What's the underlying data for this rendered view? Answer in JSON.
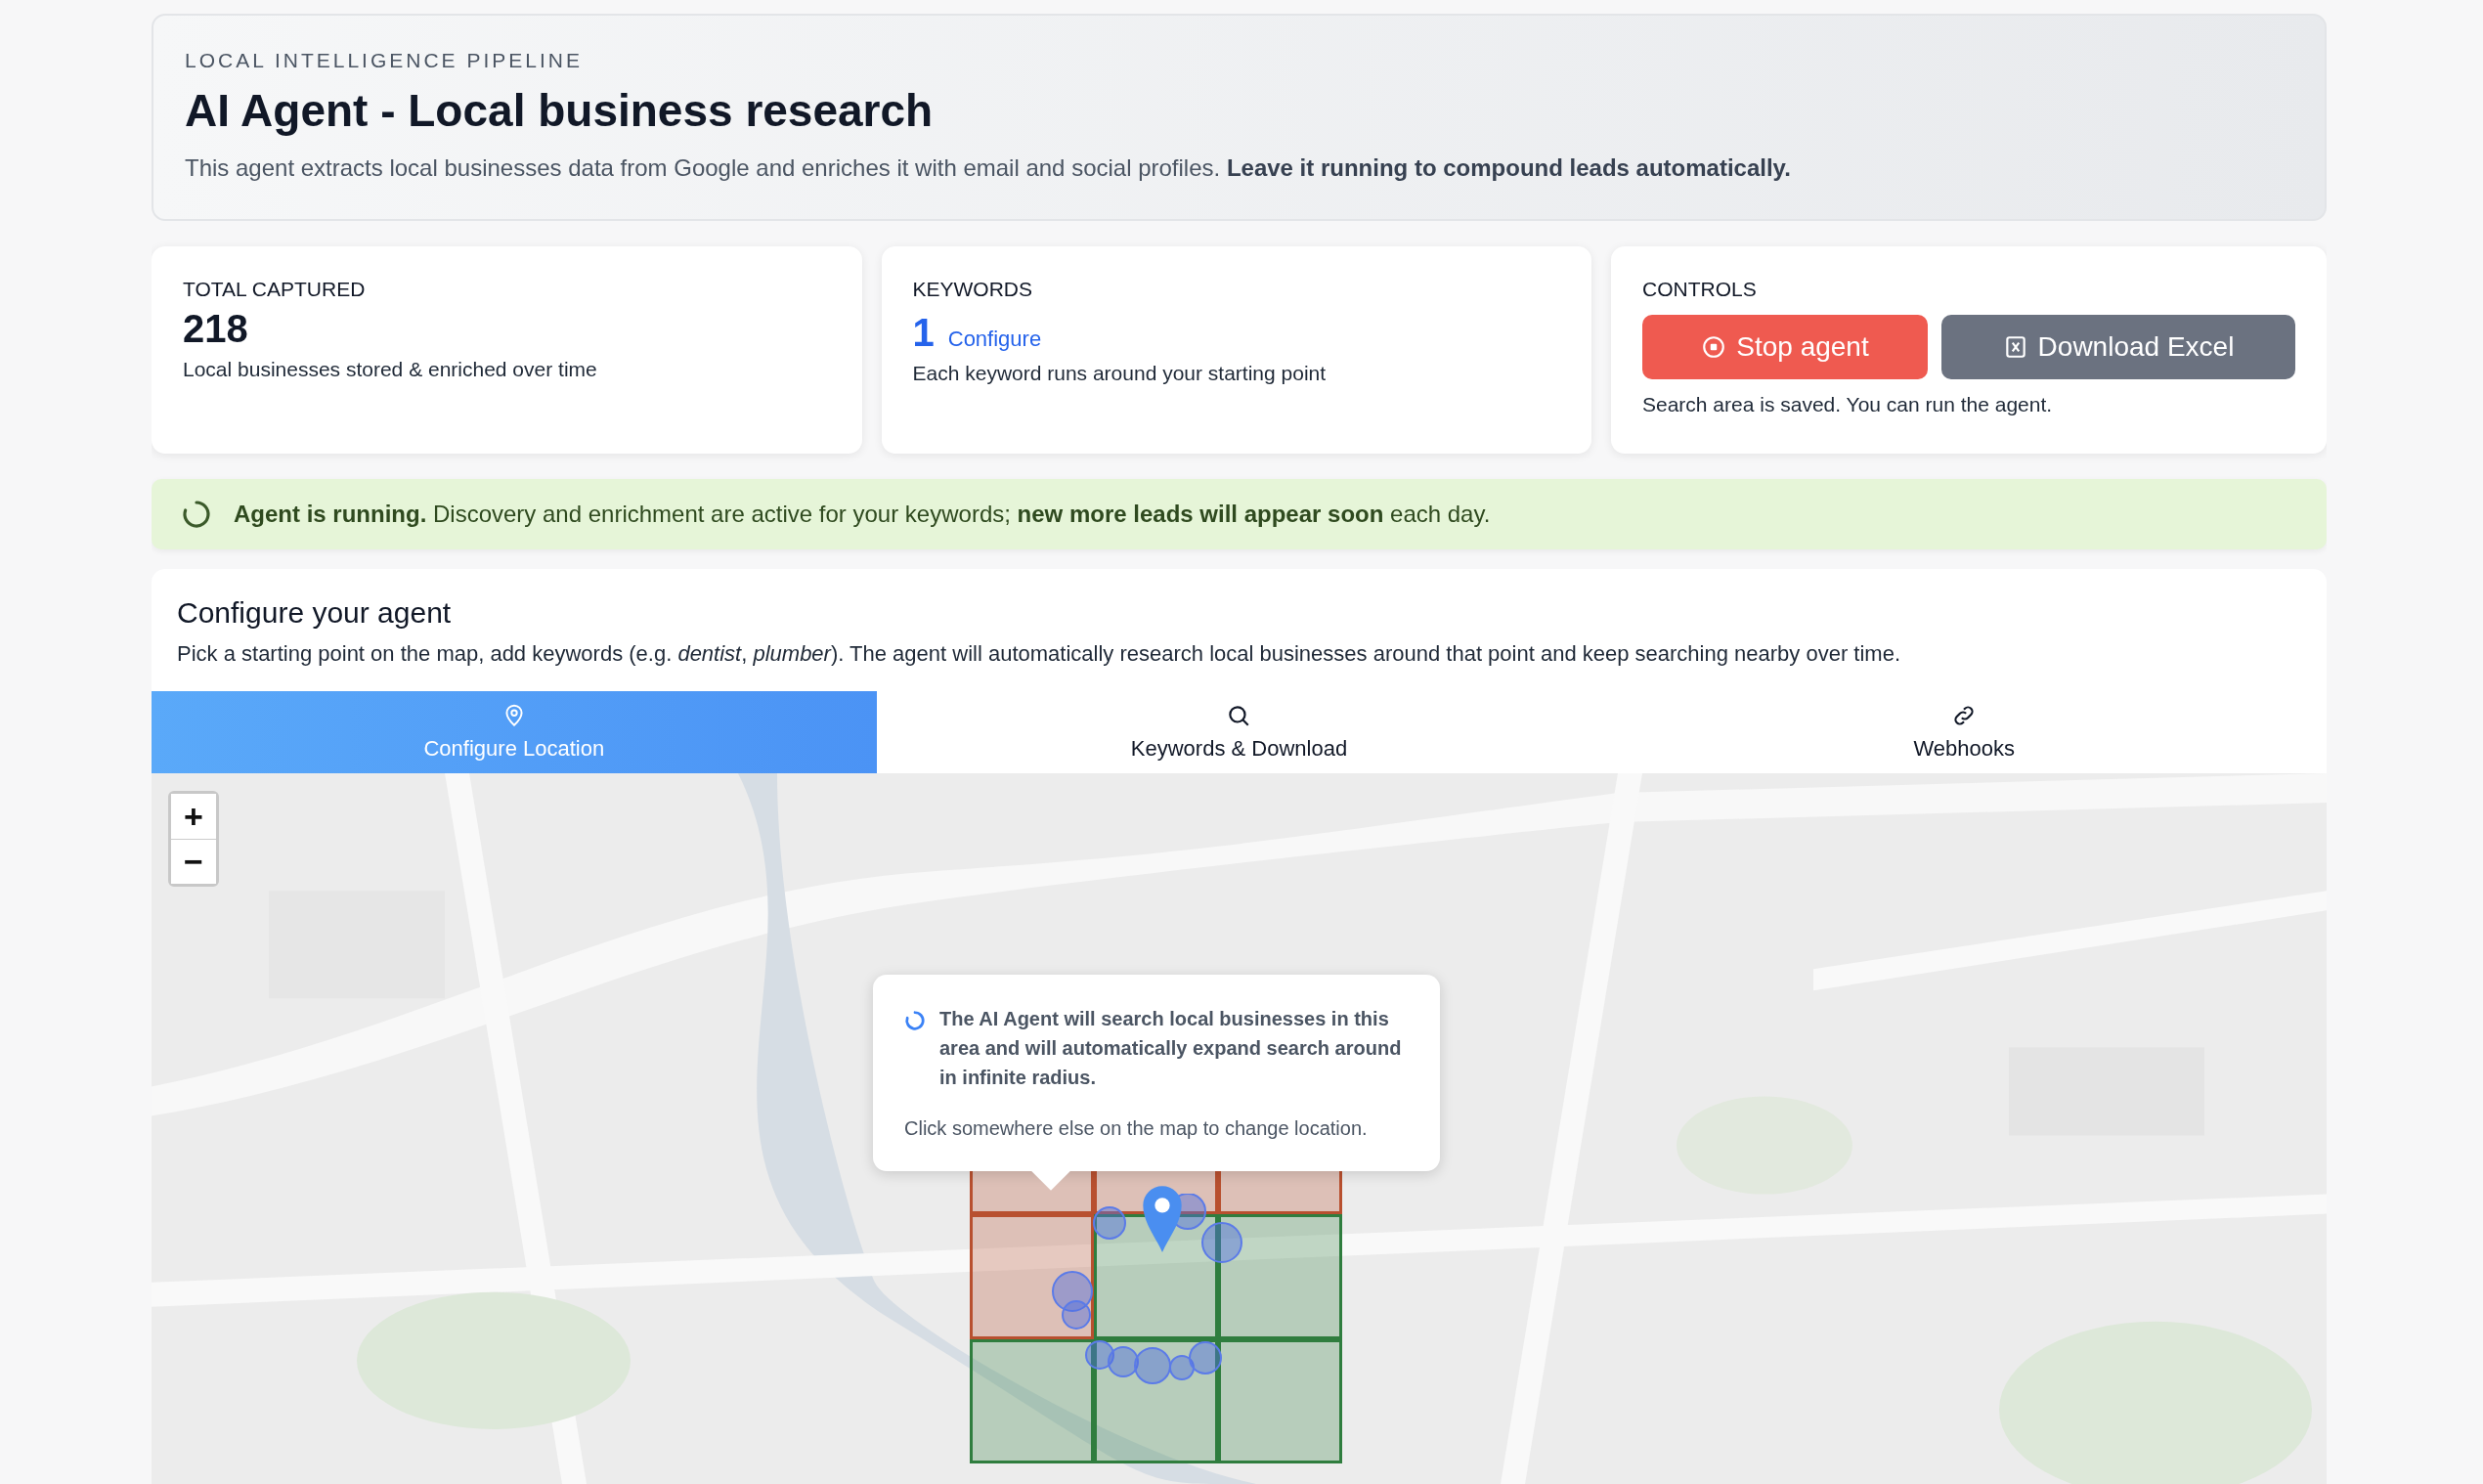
{
  "header": {
    "eyebrow": "LOCAL INTELLIGENCE PIPELINE",
    "title": "AI Agent - Local business research",
    "description": "This agent extracts local businesses data from Google and enriches it with email and social profiles. **Leave it running to compound leads automatically.**"
  },
  "stats": [
    {
      "kind": "count",
      "label": "TOTAL CAPTURED",
      "value": "218",
      "note": "Local businesses stored & enriched over time"
    },
    {
      "kind": "link",
      "label": "KEYWORDS",
      "value": "1",
      "link": "Configure",
      "note": "Each keyword runs around your starting point"
    }
  ],
  "controls": {
    "label": "CONTROLS",
    "buttons": [
      {
        "kind": "stop",
        "label": "Stop agent"
      },
      {
        "kind": "download",
        "label": "Download Excel"
      }
    ],
    "note": "Search area is saved. You can run the agent."
  },
  "status_banner": {
    "running": true,
    "text": "**Agent is running.** Discovery and enrichment are active for your keywords; **new more leads will appear soon** each day."
  },
  "configure": {
    "title": "Configure your agent",
    "description": "Pick a starting point on the map, add keywords (e.g. *dentist*, *plumber*). The agent will automatically research local businesses around that point and keep searching nearby over time.",
    "tabs": [
      {
        "kind": "location",
        "label": "Configure Location",
        "selected": true
      },
      {
        "kind": "keywords",
        "label": "Keywords & Download",
        "selected": false
      },
      {
        "kind": "webhooks",
        "label": "Webhooks",
        "selected": false
      }
    ]
  },
  "map": {
    "zoom_in": "+",
    "zoom_out": "−",
    "popup": {
      "headline": "The AI Agent will search local businesses in this area and will automatically expand search around in infinite radius.",
      "hint": "Click somewhere else on the map to change location."
    },
    "grid": [
      {
        "color": "#b8502f"
      },
      {
        "color": "#b8502f"
      },
      {
        "color": "#b8502f"
      },
      {
        "color": "#b8502f"
      },
      {
        "color": "#2f7d3e"
      },
      {
        "color": "#2f7d3e"
      },
      {
        "color": "#2f7d3e"
      },
      {
        "color": "#2f7d3e"
      },
      {
        "color": "#2f7d3e"
      }
    ]
  }
}
